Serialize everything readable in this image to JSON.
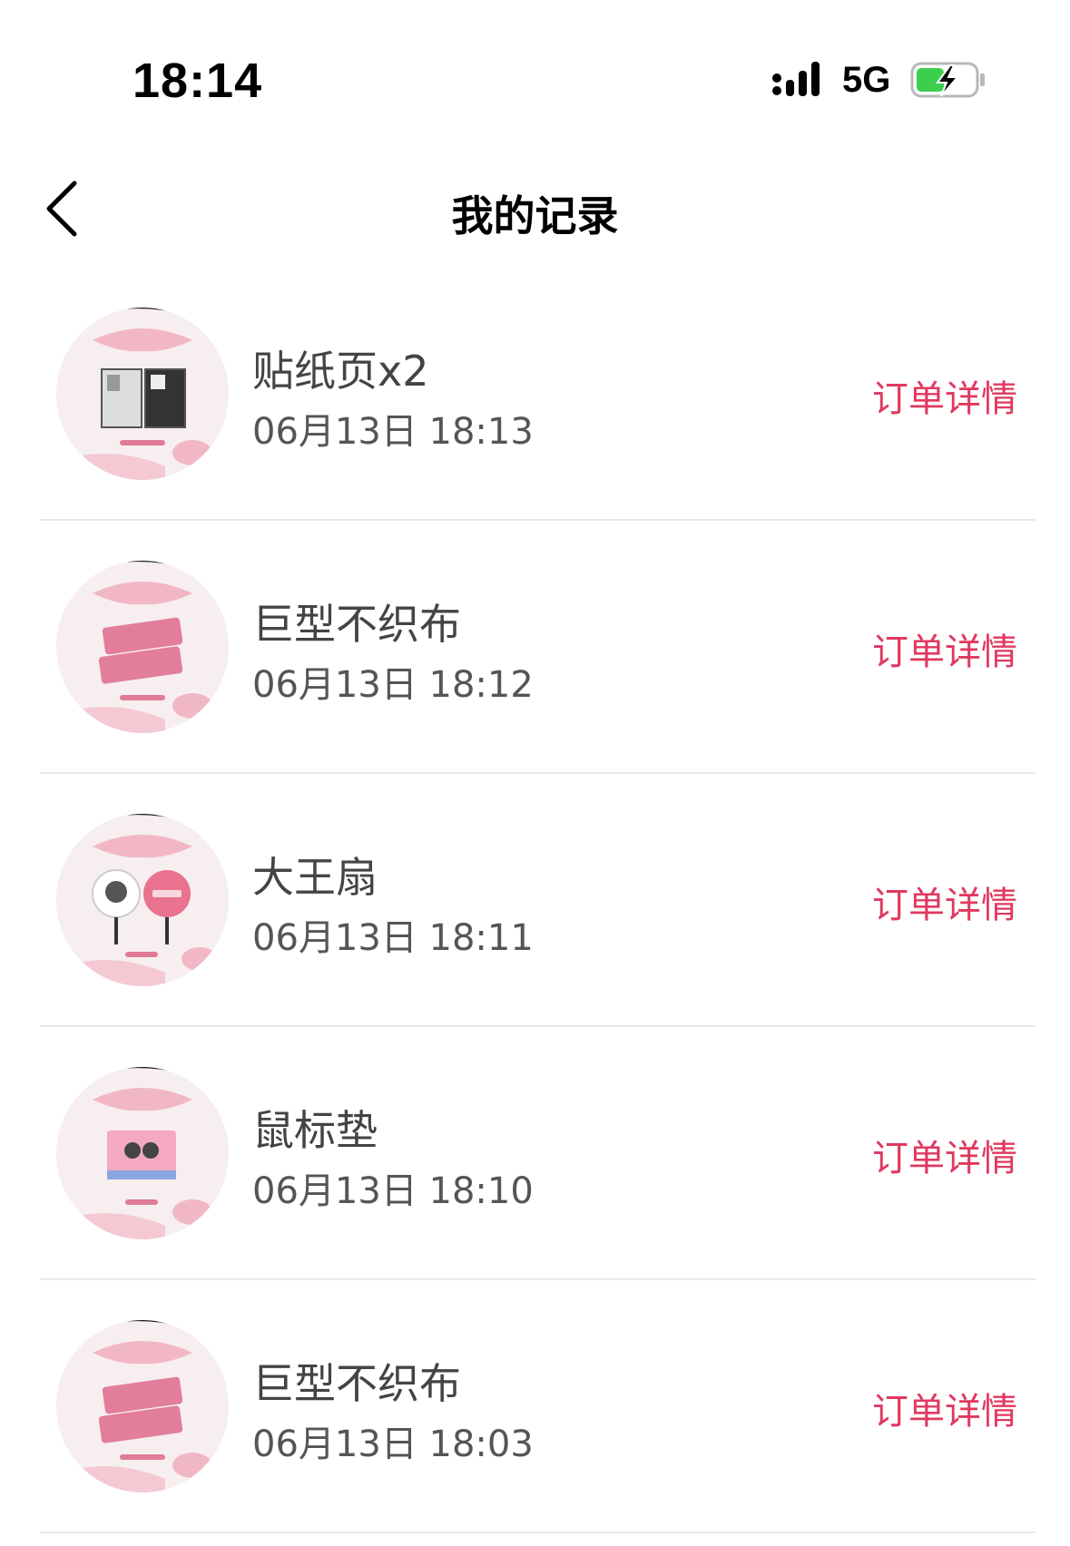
{
  "status_bar": {
    "time": "18:14",
    "network": "5G",
    "icons": [
      "signal-icon",
      "battery-charging-icon"
    ]
  },
  "nav": {
    "title": "我的记录",
    "back_icon": "chevron-left-icon"
  },
  "colors": {
    "accent": "#e0385f",
    "thumb_bg": "#f7eef0",
    "thumb_pink": "#f2b7c6",
    "divider": "#e8e8e8"
  },
  "records": [
    {
      "name": "贴纸页x2",
      "time": "06月13日 18:13",
      "action": "订单详情",
      "thumb": "sticker-sheet-thumbnail"
    },
    {
      "name": "巨型不织布",
      "time": "06月13日 18:12",
      "action": "订单详情",
      "thumb": "banner-thumbnail"
    },
    {
      "name": "大王扇",
      "time": "06月13日 18:11",
      "action": "订单详情",
      "thumb": "fan-thumbnail"
    },
    {
      "name": "鼠标垫",
      "time": "06月13日 18:10",
      "action": "订单详情",
      "thumb": "mousepad-thumbnail"
    },
    {
      "name": "巨型不织布",
      "time": "06月13日 18:03",
      "action": "订单详情",
      "thumb": "banner-thumbnail"
    }
  ]
}
